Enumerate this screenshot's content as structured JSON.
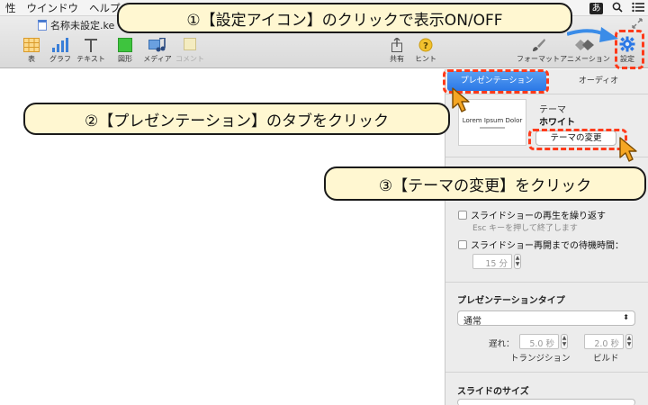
{
  "menubar": {
    "items": [
      "性",
      "ウインドウ",
      "ヘルプ"
    ],
    "ime": "あ"
  },
  "document": {
    "title": "名称未設定.ke"
  },
  "toolbar": {
    "left_items": [
      {
        "label": "表",
        "icon": "table-icon"
      },
      {
        "label": "グラフ",
        "icon": "chart-icon"
      },
      {
        "label": "テキスト",
        "icon": "text-icon"
      },
      {
        "label": "図形",
        "icon": "shape-icon"
      },
      {
        "label": "メディア",
        "icon": "media-icon"
      },
      {
        "label": "コメント",
        "icon": "comment-icon"
      }
    ],
    "share_label": "共有",
    "hint_label": "ヒント",
    "format_label": "フォーマット",
    "animation_label": "アニメーション",
    "settings_label": "設定"
  },
  "inspector": {
    "tabs": [
      "プレゼンテーション",
      "オーディオ"
    ],
    "theme_thumb_text": "Lorem Ipsum Dolor",
    "theme_label": "テーマ",
    "theme_name": "ホワイト",
    "change_theme_button": "テーマの変更",
    "loop_label": "スライドショーの再生を繰り返す",
    "esc_hint": "Esc キーを押して終了します",
    "restart_label": "スライドショー再開までの待機時間：",
    "restart_value": "15 分",
    "pres_type_title": "プレゼンテーションタイプ",
    "pres_type_value": "通常",
    "delay_label": "遅れ：",
    "transition_value": "5.0 秒",
    "build_value": "2.0 秒",
    "transition_label": "トランジション",
    "build_label": "ビルド",
    "slide_size_title": "スライドのサイズ"
  },
  "annotations": {
    "callout1": "①【設定アイコン】のクリックで表示ON/OFF",
    "callout2": "②【プレゼンテーション】のタブをクリック",
    "callout3": "③【テーマの変更】をクリック"
  },
  "colors": {
    "accent_blue": "#2a77e6",
    "callout_bg": "#fff7d1",
    "highlight_red": "#ff3a1a",
    "arrow_blue": "#3a8ce8",
    "cursor_orange": "#f5a623"
  }
}
